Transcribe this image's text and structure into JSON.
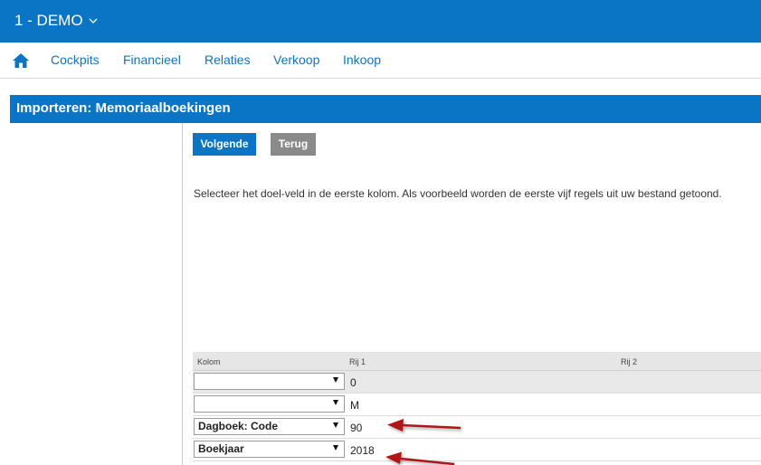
{
  "header": {
    "company": "1 - DEMO",
    "chevron_icon": "chevron-down-icon"
  },
  "nav": {
    "home_icon": "home-icon",
    "items": [
      "Cockpits",
      "Financieel",
      "Relaties",
      "Verkoop",
      "Inkoop"
    ]
  },
  "page": {
    "title": "Importeren: Memoriaalboekingen",
    "next_label": "Volgende",
    "back_label": "Terug",
    "instruction": "Selecteer het doel-veld in de eerste kolom. Als voorbeeld worden de eerste vijf regels uit uw bestand getoond."
  },
  "grid": {
    "headers": [
      "Kolom",
      "Rij 1",
      "Rij 2"
    ],
    "rows": [
      {
        "select": "",
        "row1": "0"
      },
      {
        "select": "",
        "row1": "M"
      },
      {
        "select": "Dagboek: Code",
        "row1": "90"
      },
      {
        "select": "Boekjaar",
        "row1": "2018"
      }
    ]
  },
  "colors": {
    "brand_blue": "#0a74c5",
    "nav_link": "#1273b8",
    "annotation_arrow": "#b01919",
    "secondary_button": "#8a8a8a"
  }
}
